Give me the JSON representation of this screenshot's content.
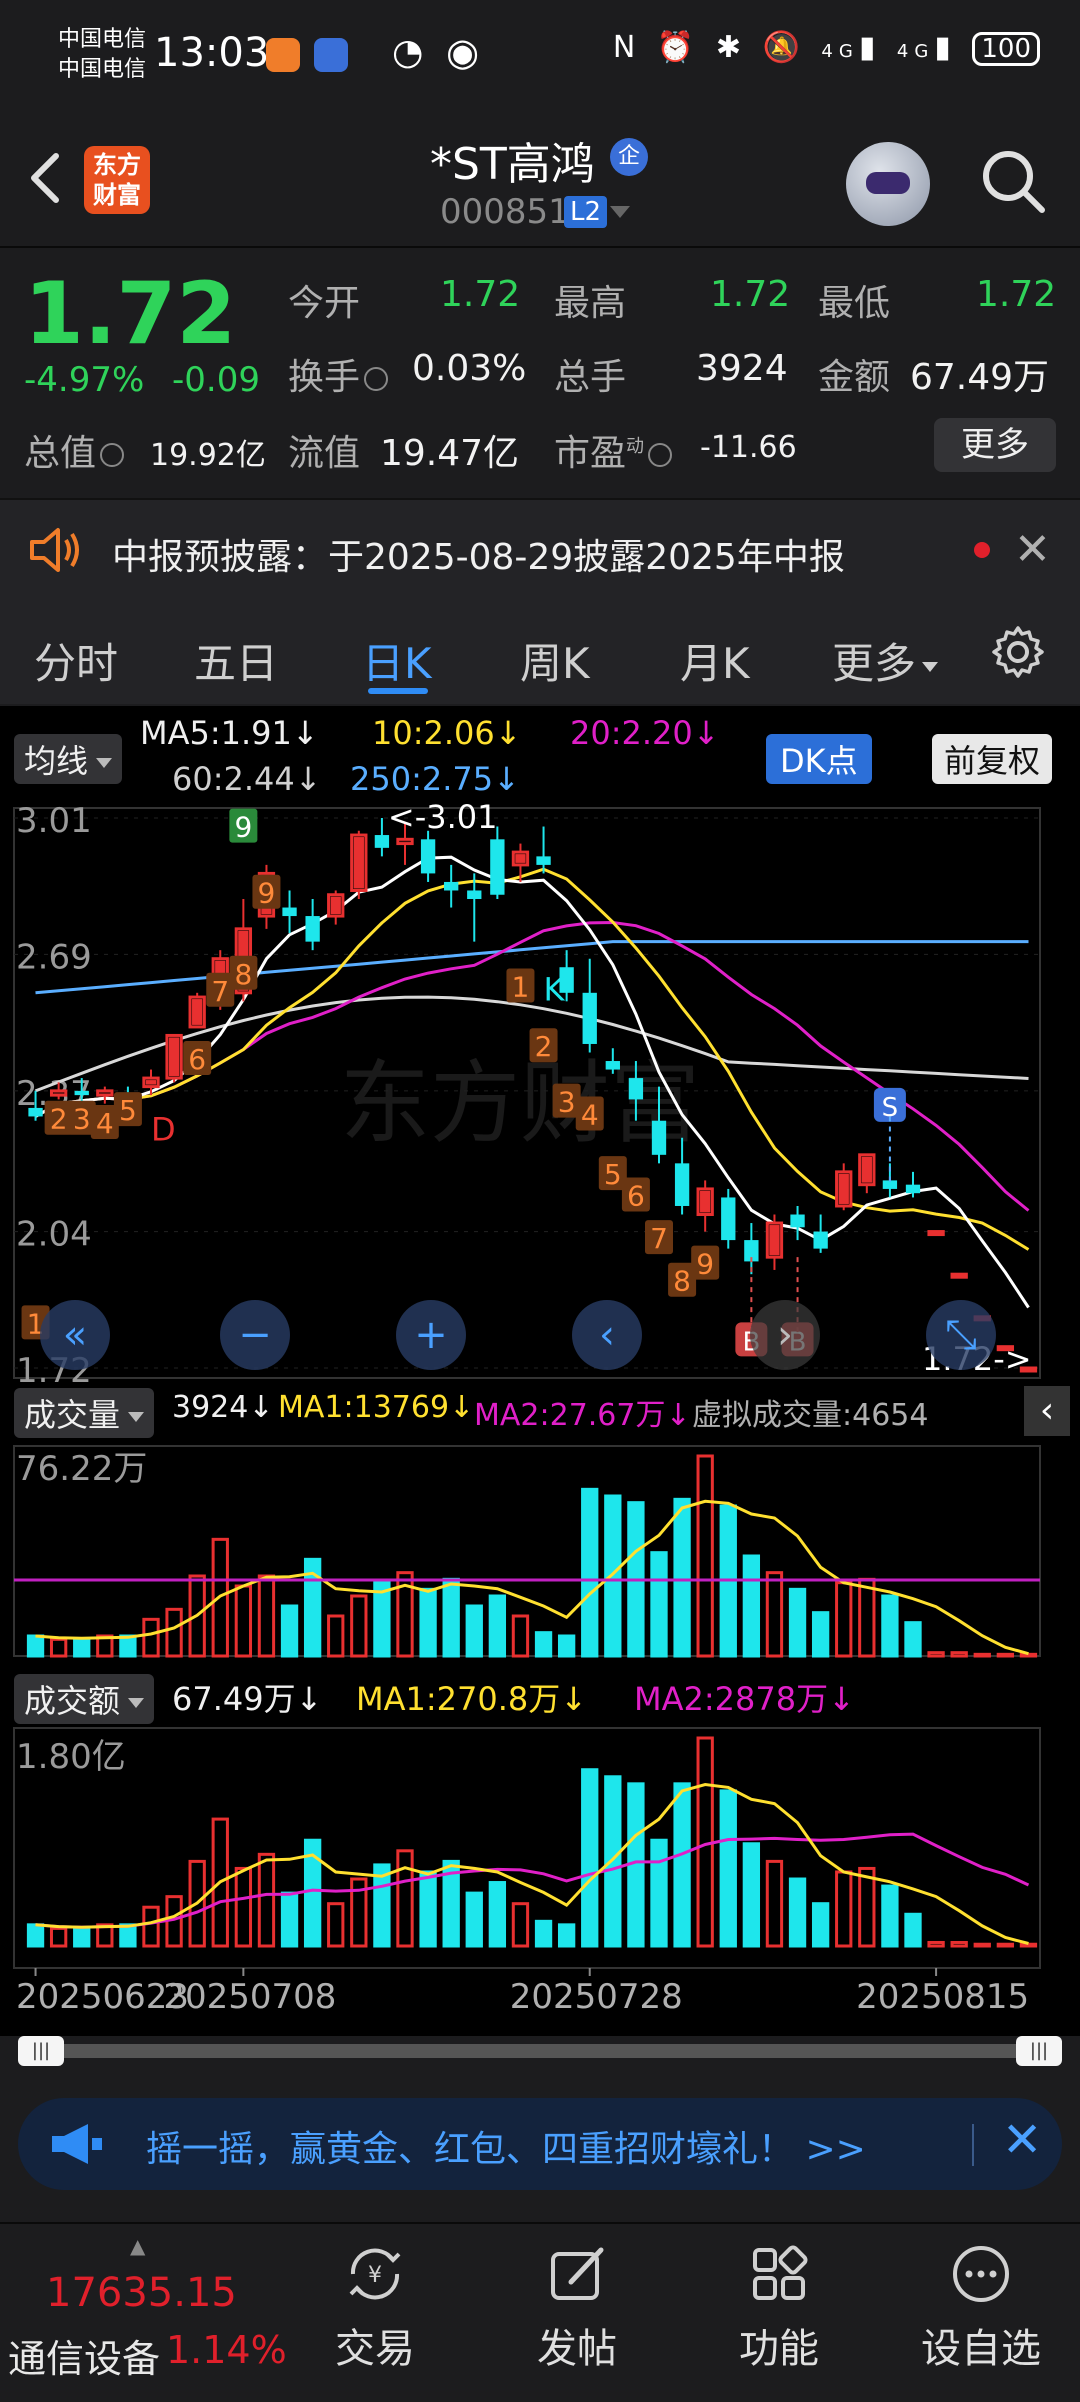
{
  "status_bar": {
    "carrier1": "中国电信",
    "carrier2": "中国电信",
    "time": "13:03",
    "network1": "4G",
    "network2": "4G",
    "battery": "100"
  },
  "header": {
    "logo_text": "东方财富",
    "stock_name": "*ST高鸿",
    "qi_badge": "企",
    "stock_code": "000851",
    "level_badge": "L2"
  },
  "quote": {
    "price": "1.72",
    "change_pct": "-4.97%",
    "change_amt": "-0.09",
    "open_label": "今开",
    "open": "1.72",
    "high_label": "最高",
    "high": "1.72",
    "low_label": "最低",
    "low": "1.72",
    "turnover_label": "换手",
    "turnover": "0.03%",
    "volume_label": "总手",
    "volume": "3924",
    "amount_label": "金额",
    "amount": "67.49万",
    "mktcap_label": "总值",
    "mktcap": "19.92亿",
    "float_label": "流值",
    "float": "19.47亿",
    "pe_label": "市盈",
    "pe_sup": "动",
    "pe": "-11.66",
    "more": "更多"
  },
  "notice": {
    "text": "中报预披露：于2025-08-29披露2025年中报"
  },
  "tabs": {
    "items": [
      "分时",
      "五日",
      "日K",
      "周K",
      "月K",
      "更多"
    ],
    "active": "日K"
  },
  "chart": {
    "ma_dropdown": "均线",
    "ma5": "MA5:1.91↓",
    "ma10": "10:2.06↓",
    "ma20": "20:2.20↓",
    "ma60": "60:2.44↓",
    "ma250": "250:2.75↓",
    "dk_button": "DK点",
    "adjust_button": "前复权",
    "y_labels": [
      "3.01",
      "2.69",
      "2.37",
      "2.04",
      "1.72"
    ],
    "high_marker": "<-3.01",
    "last_marker": "1.72->",
    "dates": [
      "20250623",
      "20250708",
      "20250728",
      "20250815"
    ],
    "vol_dropdown": "成交量",
    "vol_value": "3924↓",
    "vol_ma1": "MA1:13769↓",
    "vol_ma2": "MA2:27.67万↓",
    "vol_virtual": "虚拟成交量:4654",
    "vol_max": "76.22万",
    "amt_dropdown": "成交额",
    "amt_value": "67.49万↓",
    "amt_ma1": "MA1:270.8万↓",
    "amt_ma2": "MA2:2878万↓",
    "amt_max": "1.80亿",
    "signal_labels": {
      "up": [
        "1",
        "2",
        "3",
        "4",
        "5",
        "6",
        "7",
        "8",
        "9"
      ],
      "down": [
        "1",
        "2",
        "3",
        "4",
        "5",
        "6",
        "7",
        "8",
        "9"
      ],
      "d": "D",
      "k": "K",
      "s": "S",
      "b": "B"
    }
  },
  "chart_data": {
    "type": "candlestick",
    "y_axis_labels": [
      3.01,
      2.69,
      2.37,
      2.04,
      1.72
    ],
    "ylim": [
      1.72,
      3.01
    ],
    "candles": [
      {
        "o": 2.33,
        "h": 2.37,
        "l": 2.3,
        "c": 2.31
      },
      {
        "o": 2.36,
        "h": 2.39,
        "l": 2.35,
        "c": 2.37
      },
      {
        "o": 2.37,
        "h": 2.4,
        "l": 2.34,
        "c": 2.36
      },
      {
        "o": 2.36,
        "h": 2.38,
        "l": 2.34,
        "c": 2.37
      },
      {
        "o": 2.36,
        "h": 2.38,
        "l": 2.33,
        "c": 2.34
      },
      {
        "o": 2.38,
        "h": 2.42,
        "l": 2.36,
        "c": 2.4
      },
      {
        "o": 2.4,
        "h": 2.5,
        "l": 2.39,
        "c": 2.5
      },
      {
        "o": 2.52,
        "h": 2.6,
        "l": 2.52,
        "c": 2.59
      },
      {
        "o": 2.58,
        "h": 2.7,
        "l": 2.56,
        "c": 2.68
      },
      {
        "o": 2.6,
        "h": 2.82,
        "l": 2.58,
        "c": 2.75
      },
      {
        "o": 2.78,
        "h": 2.9,
        "l": 2.75,
        "c": 2.88
      },
      {
        "o": 2.8,
        "h": 2.84,
        "l": 2.74,
        "c": 2.78
      },
      {
        "o": 2.78,
        "h": 2.82,
        "l": 2.7,
        "c": 2.72
      },
      {
        "o": 2.78,
        "h": 2.84,
        "l": 2.76,
        "c": 2.83
      },
      {
        "o": 2.84,
        "h": 2.98,
        "l": 2.82,
        "c": 2.97
      },
      {
        "o": 2.97,
        "h": 3.01,
        "l": 2.92,
        "c": 2.94
      },
      {
        "o": 2.95,
        "h": 3.0,
        "l": 2.9,
        "c": 2.96
      },
      {
        "o": 2.96,
        "h": 2.98,
        "l": 2.86,
        "c": 2.88
      },
      {
        "o": 2.86,
        "h": 2.9,
        "l": 2.8,
        "c": 2.84
      },
      {
        "o": 2.84,
        "h": 2.88,
        "l": 2.72,
        "c": 2.82
      },
      {
        "o": 2.96,
        "h": 2.99,
        "l": 2.82,
        "c": 2.83
      },
      {
        "o": 2.9,
        "h": 2.95,
        "l": 2.86,
        "c": 2.93
      },
      {
        "o": 2.92,
        "h": 2.99,
        "l": 2.88,
        "c": 2.9
      },
      {
        "o": 2.66,
        "h": 2.7,
        "l": 2.58,
        "c": 2.6
      },
      {
        "o": 2.6,
        "h": 2.68,
        "l": 2.46,
        "c": 2.48
      },
      {
        "o": 2.44,
        "h": 2.47,
        "l": 2.41,
        "c": 2.42
      },
      {
        "o": 2.4,
        "h": 2.44,
        "l": 2.3,
        "c": 2.35
      },
      {
        "o": 2.3,
        "h": 2.38,
        "l": 2.2,
        "c": 2.22
      },
      {
        "o": 2.2,
        "h": 2.26,
        "l": 2.08,
        "c": 2.1
      },
      {
        "o": 2.08,
        "h": 2.16,
        "l": 2.04,
        "c": 2.14
      },
      {
        "o": 2.12,
        "h": 2.14,
        "l": 2.0,
        "c": 2.02
      },
      {
        "o": 2.02,
        "h": 2.06,
        "l": 1.94,
        "c": 1.97
      },
      {
        "o": 1.98,
        "h": 2.08,
        "l": 1.95,
        "c": 2.06
      },
      {
        "o": 2.08,
        "h": 2.1,
        "l": 2.02,
        "c": 2.05
      },
      {
        "o": 2.04,
        "h": 2.08,
        "l": 1.99,
        "c": 2.0
      },
      {
        "o": 2.1,
        "h": 2.2,
        "l": 2.09,
        "c": 2.18
      },
      {
        "o": 2.15,
        "h": 2.22,
        "l": 2.13,
        "c": 2.22
      },
      {
        "o": 2.16,
        "h": 2.2,
        "l": 2.12,
        "c": 2.14
      },
      {
        "o": 2.15,
        "h": 2.18,
        "l": 2.12,
        "c": 2.13
      },
      {
        "o": 2.04,
        "h": 2.04,
        "l": 2.04,
        "c": 2.04
      },
      {
        "o": 1.94,
        "h": 1.94,
        "l": 1.94,
        "c": 1.94
      },
      {
        "o": 1.84,
        "h": 1.84,
        "l": 1.84,
        "c": 1.84
      },
      {
        "o": 1.77,
        "h": 1.77,
        "l": 1.77,
        "c": 1.77
      },
      {
        "o": 1.72,
        "h": 1.72,
        "l": 1.72,
        "c": 1.72
      }
    ],
    "volume_max_label": "76.22万",
    "volume": [
      12,
      10,
      10,
      12,
      12,
      22,
      28,
      48,
      70,
      42,
      48,
      30,
      58,
      24,
      36,
      44,
      50,
      40,
      46,
      30,
      36,
      24,
      14,
      12,
      100,
      96,
      92,
      62,
      94,
      120,
      90,
      60,
      50,
      40,
      26,
      44,
      46,
      36,
      20,
      2,
      2,
      1,
      1,
      1
    ],
    "amount_max_label": "1.80亿",
    "amount": [
      12,
      10,
      10,
      12,
      12,
      22,
      28,
      48,
      72,
      44,
      52,
      30,
      60,
      24,
      38,
      46,
      54,
      42,
      48,
      30,
      36,
      24,
      14,
      12,
      100,
      96,
      92,
      60,
      92,
      118,
      88,
      58,
      48,
      38,
      24,
      42,
      44,
      34,
      18,
      2,
      2,
      1,
      1,
      1
    ],
    "x_date_labels": [
      "20250623",
      "20250708",
      "20250728",
      "20250815"
    ]
  },
  "promo": {
    "text": "摇一摇，赢黄金、红包、四重招财壕礼！ >>"
  },
  "bottom_nav": {
    "index_value": "17635.15",
    "index_name": "通信设备",
    "index_pct": "1.14%",
    "items": [
      "交易",
      "发帖",
      "功能",
      "设自选"
    ]
  }
}
